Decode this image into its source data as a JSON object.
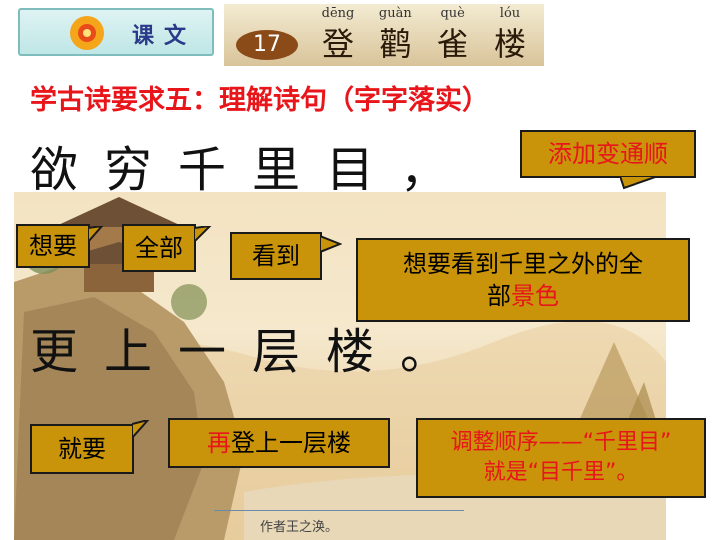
{
  "header": {
    "label": "课文",
    "lesson_number": "17",
    "pinyin": [
      "dēng",
      "guàn",
      "què",
      "lóu"
    ],
    "title_chars": [
      "登",
      "鹳",
      "雀",
      "楼"
    ]
  },
  "heading": "学古诗要求五：理解诗句（字字落实）",
  "poem": {
    "line1": "欲穷千里目，",
    "line2": "更上一层楼。"
  },
  "callouts": {
    "add_change": "添加变通顺",
    "want": "想要",
    "all": "全部",
    "see": "看到",
    "meaning_part1": "想要看到千里之外的全",
    "meaning_part2": "部",
    "meaning_red": "景色",
    "then": "就要",
    "again_red": "再",
    "again_rest": "登上一层楼",
    "reorder_line1": "调整顺序——“千里目”",
    "reorder_line2": "就是“目千里”。"
  },
  "painting_caption": "作者王之涣。",
  "colors": {
    "heading_red": "#e8151b",
    "callout_gold": "#c9930a"
  }
}
